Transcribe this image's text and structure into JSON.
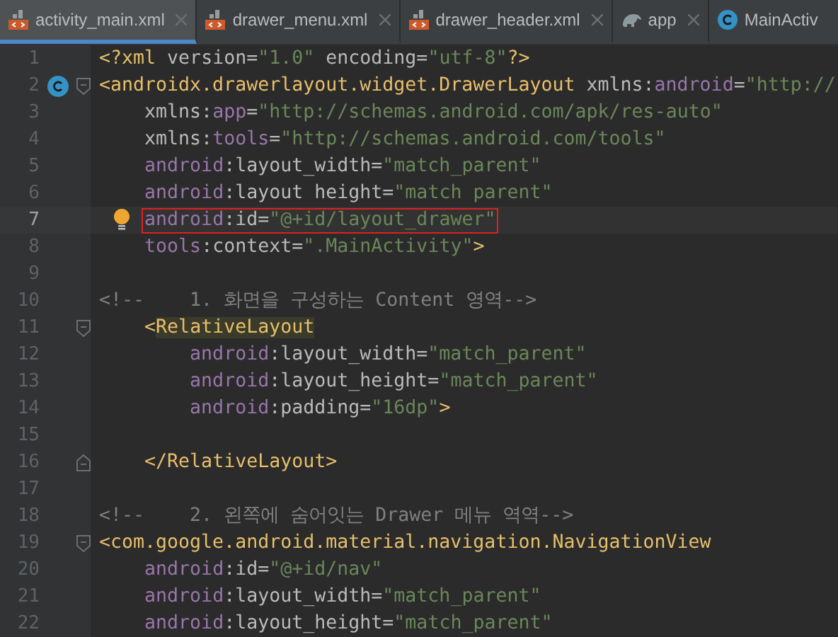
{
  "tabs": [
    {
      "label": "activity_main.xml",
      "kind": "xml",
      "selected": true
    },
    {
      "label": "drawer_menu.xml",
      "kind": "xml",
      "selected": false
    },
    {
      "label": "drawer_header.xml",
      "kind": "xml",
      "selected": false
    },
    {
      "label": "app",
      "kind": "gradle",
      "selected": false
    },
    {
      "label": "MainActiv",
      "kind": "class",
      "selected": false
    }
  ],
  "lines": [
    {
      "number": "1",
      "current": false,
      "boxed": false,
      "tokens": [
        {
          "kind": "tag",
          "text": "<?xml "
        },
        {
          "kind": "attr",
          "text": "version="
        },
        {
          "kind": "value",
          "text": "\"1.0\" "
        },
        {
          "kind": "attr",
          "text": "encoding="
        },
        {
          "kind": "value",
          "text": "\"utf-8\""
        },
        {
          "kind": "tag",
          "text": "?>"
        }
      ]
    },
    {
      "number": "2",
      "class_icon": true,
      "fold_start": true,
      "current": false,
      "boxed": false,
      "tokens": [
        {
          "kind": "tag",
          "text": "<androidx.drawerlayout.widget.DrawerLayout "
        },
        {
          "kind": "attr",
          "text": "xmlns:"
        },
        {
          "kind": "ns",
          "text": "android"
        },
        {
          "kind": "attr",
          "text": "="
        },
        {
          "kind": "value",
          "text": "\"http://"
        }
      ]
    },
    {
      "number": "3",
      "current": false,
      "boxed": false,
      "tokens": [
        {
          "kind": "attr",
          "text": "    xmlns:"
        },
        {
          "kind": "ns",
          "text": "app"
        },
        {
          "kind": "attr",
          "text": "="
        },
        {
          "kind": "value",
          "text": "\"http://schemas.android.com/apk/res-auto\""
        }
      ]
    },
    {
      "number": "4",
      "current": false,
      "boxed": false,
      "tokens": [
        {
          "kind": "attr",
          "text": "    xmlns:"
        },
        {
          "kind": "ns",
          "text": "tools"
        },
        {
          "kind": "attr",
          "text": "="
        },
        {
          "kind": "value",
          "text": "\"http://schemas.android.com/tools\""
        }
      ]
    },
    {
      "number": "5",
      "current": false,
      "boxed": false,
      "tokens": [
        {
          "kind": "ns",
          "text": "    android"
        },
        {
          "kind": "attr",
          "text": ":layout_width="
        },
        {
          "kind": "value",
          "text": "\"match_parent\""
        }
      ]
    },
    {
      "number": "6",
      "current": false,
      "boxed": false,
      "tokens": [
        {
          "kind": "ns",
          "text": "    android"
        },
        {
          "kind": "attr",
          "text": ":layout height="
        },
        {
          "kind": "value",
          "text": "\"match parent\""
        }
      ]
    },
    {
      "number": "7",
      "bulb_icon": true,
      "current": true,
      "boxed": true,
      "tokens": [
        {
          "kind": "ns",
          "text": "    android"
        },
        {
          "kind": "attr",
          "text": ":id="
        },
        {
          "kind": "value",
          "text": "\"@+id/layout_drawer\""
        }
      ]
    },
    {
      "number": "8",
      "current": false,
      "boxed": false,
      "tokens": [
        {
          "kind": "ns",
          "text": "    tools"
        },
        {
          "kind": "attr",
          "text": ":context="
        },
        {
          "kind": "value",
          "text": "\".MainActivity\""
        },
        {
          "kind": "tag",
          "text": ">"
        }
      ]
    },
    {
      "number": "9",
      "current": false
    },
    {
      "number": "10",
      "current": false,
      "boxed": false,
      "tokens": [
        {
          "kind": "comment",
          "text": "<!--    1. 화면을 구성하는 Content 영역-->"
        }
      ]
    },
    {
      "number": "11",
      "fold_start": true,
      "current": false,
      "boxed": false,
      "tokens": [
        {
          "kind": "tag",
          "text": "    <"
        },
        {
          "kind": "match",
          "text": "RelativeLayout"
        }
      ]
    },
    {
      "number": "12",
      "current": false,
      "boxed": false,
      "tokens": [
        {
          "kind": "ns",
          "text": "        android"
        },
        {
          "kind": "attr",
          "text": ":layout_width="
        },
        {
          "kind": "value",
          "text": "\"match_parent\""
        }
      ]
    },
    {
      "number": "13",
      "current": false,
      "boxed": false,
      "tokens": [
        {
          "kind": "ns",
          "text": "        android"
        },
        {
          "kind": "attr",
          "text": ":layout_height="
        },
        {
          "kind": "value",
          "text": "\"match_parent\""
        }
      ]
    },
    {
      "number": "14",
      "current": false,
      "boxed": false,
      "tokens": [
        {
          "kind": "ns",
          "text": "        android"
        },
        {
          "kind": "attr",
          "text": ":padding="
        },
        {
          "kind": "value",
          "text": "\"16dp\""
        },
        {
          "kind": "tag",
          "text": ">"
        }
      ]
    },
    {
      "number": "15",
      "current": false
    },
    {
      "number": "16",
      "fold_end": true,
      "current": false,
      "boxed": false,
      "tokens": [
        {
          "kind": "tag",
          "text": "    </RelativeLayout>"
        }
      ]
    },
    {
      "number": "17",
      "current": false
    },
    {
      "number": "18",
      "current": false,
      "boxed": false,
      "tokens": [
        {
          "kind": "comment",
          "text": "<!--    2. 왼쪽에 숨어잇는 Drawer 메뉴 역역-->"
        }
      ]
    },
    {
      "number": "19",
      "fold_start": true,
      "current": false,
      "boxed": false,
      "tokens": [
        {
          "kind": "tag",
          "text": "<com.google.android.material.navigation.NavigationView"
        }
      ]
    },
    {
      "number": "20",
      "current": false,
      "boxed": false,
      "tokens": [
        {
          "kind": "ns",
          "text": "    android"
        },
        {
          "kind": "attr",
          "text": ":id="
        },
        {
          "kind": "value",
          "text": "\"@+id/nav\""
        }
      ]
    },
    {
      "number": "21",
      "current": false,
      "boxed": false,
      "tokens": [
        {
          "kind": "ns",
          "text": "    android"
        },
        {
          "kind": "attr",
          "text": ":layout_width="
        },
        {
          "kind": "value",
          "text": "\"match_parent\""
        }
      ]
    },
    {
      "number": "22",
      "current": false,
      "boxed": false,
      "tokens": [
        {
          "kind": "ns",
          "text": "    android"
        },
        {
          "kind": "attr",
          "text": ":layout_height="
        },
        {
          "kind": "value",
          "text": "\"match_parent\""
        }
      ]
    }
  ]
}
